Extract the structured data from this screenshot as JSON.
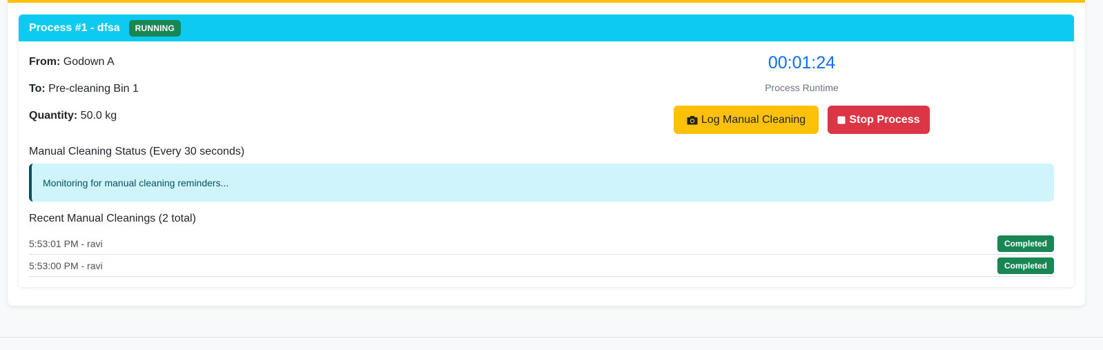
{
  "process": {
    "title": "Process #1 - dfsa",
    "status": "RUNNING",
    "from_label": "From:",
    "from_value": "Godown A",
    "to_label": "To:",
    "to_value": "Pre-cleaning Bin 1",
    "quantity_label": "Quantity:",
    "quantity_value": "50.0 kg",
    "runtime": "00:01:24",
    "runtime_label": "Process Runtime"
  },
  "actions": {
    "log_label": "Log Manual Cleaning",
    "log_icon": "camera-icon",
    "stop_label": "Stop Process",
    "stop_icon": "stop-icon"
  },
  "cleaning_status": {
    "title": "Manual Cleaning Status (Every 30 seconds)",
    "message": "Monitoring for manual cleaning reminders..."
  },
  "recent": {
    "title": "Recent Manual Cleanings (2 total)",
    "items": [
      {
        "text": "5:53:01 PM - ravi",
        "status": "Completed"
      },
      {
        "text": "5:53:00 PM - ravi",
        "status": "Completed"
      }
    ]
  },
  "colors": {
    "header": "#0dcaf0",
    "top_accent": "#ffc107",
    "running_badge": "#198754",
    "runtime_text": "#0d6efd",
    "log_button": "#ffc107",
    "stop_button": "#dc3545",
    "alert_bg": "#cff4fc"
  }
}
